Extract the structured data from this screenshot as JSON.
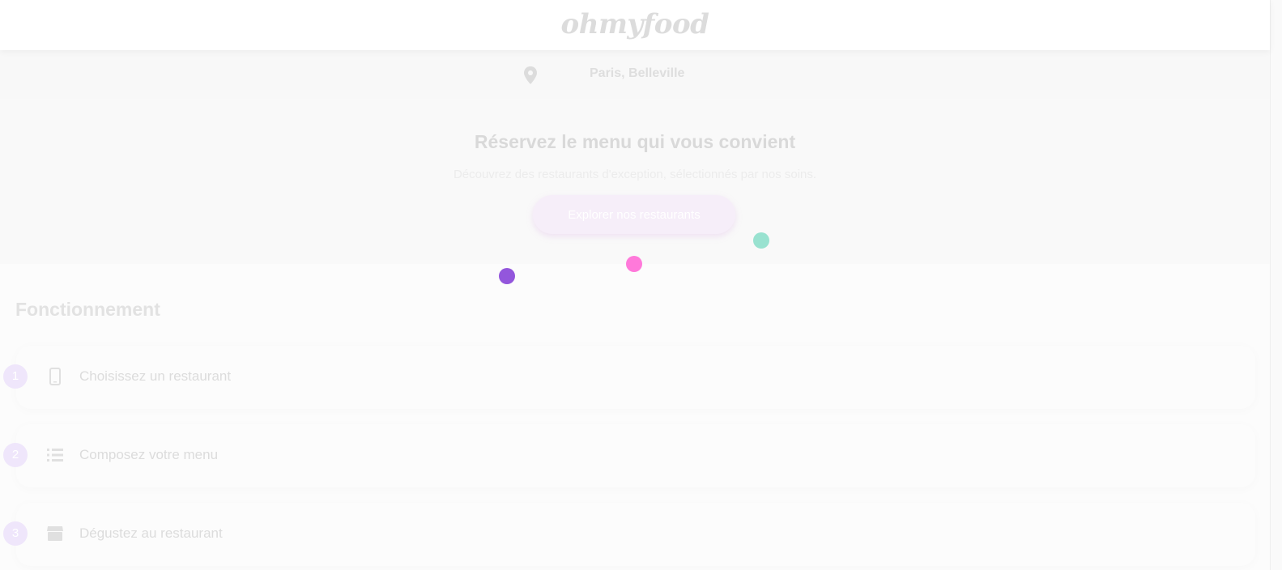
{
  "header": {
    "logo": "ohmyfood"
  },
  "location": {
    "icon": "map-pin-icon",
    "text": "Paris, Belleville"
  },
  "hero": {
    "title": "Réservez le menu qui vous convient",
    "subtitle": "Découvrez des restaurants d'exception, sélectionnés par nos soins.",
    "button_label": "Explorer nos restaurants"
  },
  "loader": {
    "dots": [
      {
        "name": "loader-dot-purple",
        "color": "#9356dc"
      },
      {
        "name": "loader-dot-pink",
        "color": "#ff79da"
      },
      {
        "name": "loader-dot-teal",
        "color": "#99e2d0"
      }
    ]
  },
  "section": {
    "title": "Fonctionnement",
    "steps": [
      {
        "number": "1",
        "icon": "mobile-phone-icon",
        "label": "Choisissez un restaurant"
      },
      {
        "number": "2",
        "icon": "list-icon",
        "label": "Composez votre menu"
      },
      {
        "number": "3",
        "icon": "store-icon",
        "label": "Dégustez au restaurant"
      }
    ]
  },
  "colors": {
    "accent_purple": "#9356dc",
    "accent_pink": "#ff79da",
    "accent_teal": "#99e2d0"
  }
}
